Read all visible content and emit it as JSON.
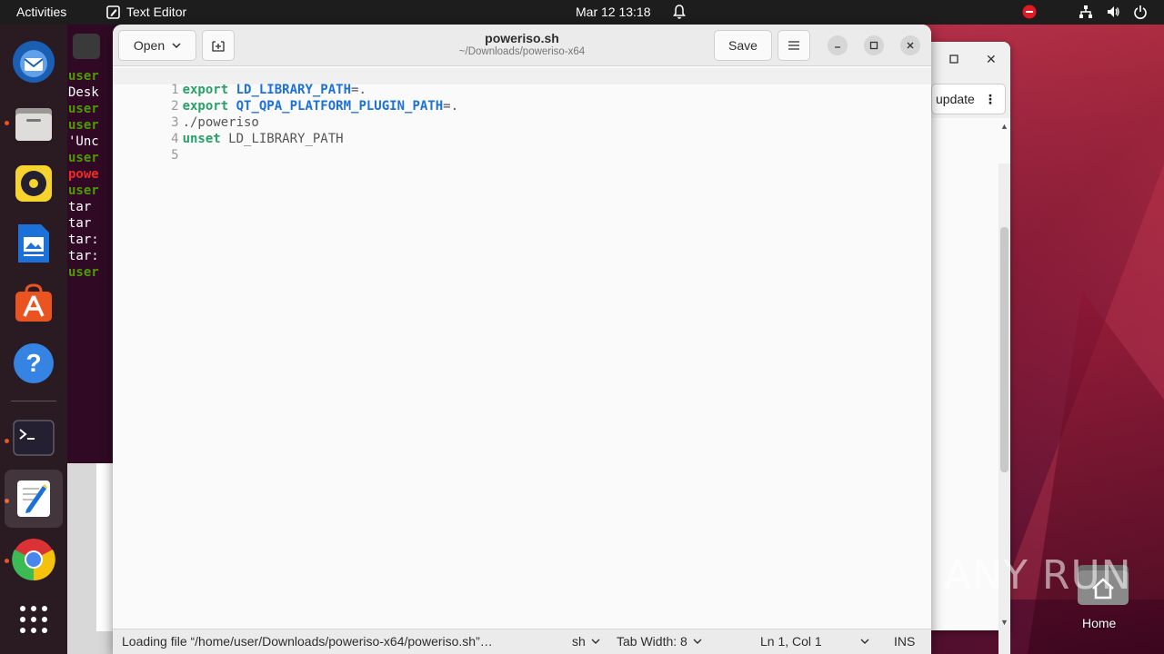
{
  "topbar": {
    "activities": "Activities",
    "app_name": "Text Editor",
    "clock": "Mar 12  13:18"
  },
  "terminal": {
    "lines": [
      "user",
      "Desk",
      "user",
      "user",
      "'Unc",
      "user",
      "powe",
      "user",
      "tar ",
      "tar ",
      "tar:",
      "tar:",
      "user"
    ]
  },
  "updater": {
    "update_label": "update"
  },
  "editor": {
    "open_label": "Open",
    "save_label": "Save",
    "title": "poweriso.sh",
    "subtitle": "~/Downloads/poweriso-x64",
    "lines": [
      {
        "num": "1"
      },
      {
        "num": "2"
      },
      {
        "num": "3"
      },
      {
        "num": "4"
      },
      {
        "num": "5"
      }
    ],
    "code": {
      "l1_kw": "export",
      "l1_var": "LD_LIBRARY_PATH",
      "l1_rest": "=.",
      "l2_kw": "export",
      "l2_var": "QT_QPA_PLATFORM_PLUGIN_PATH",
      "l2_rest": "=.",
      "l3_text": "./poweriso",
      "l4_kw": "unset",
      "l4_rest": " LD_LIBRARY_PATH"
    },
    "status": {
      "loading": "Loading file “/home/user/Downloads/poweriso-x64/poweriso.sh”…",
      "language": "sh",
      "tab_width": "Tab Width: 8",
      "position": "Ln 1, Col 1",
      "mode": "INS"
    }
  },
  "desktop": {
    "home_label": "Home"
  },
  "watermark": "ANY RUN",
  "colors": {
    "keyword": "#26a269",
    "variable": "#1c71d8",
    "accent": "#e95420"
  }
}
